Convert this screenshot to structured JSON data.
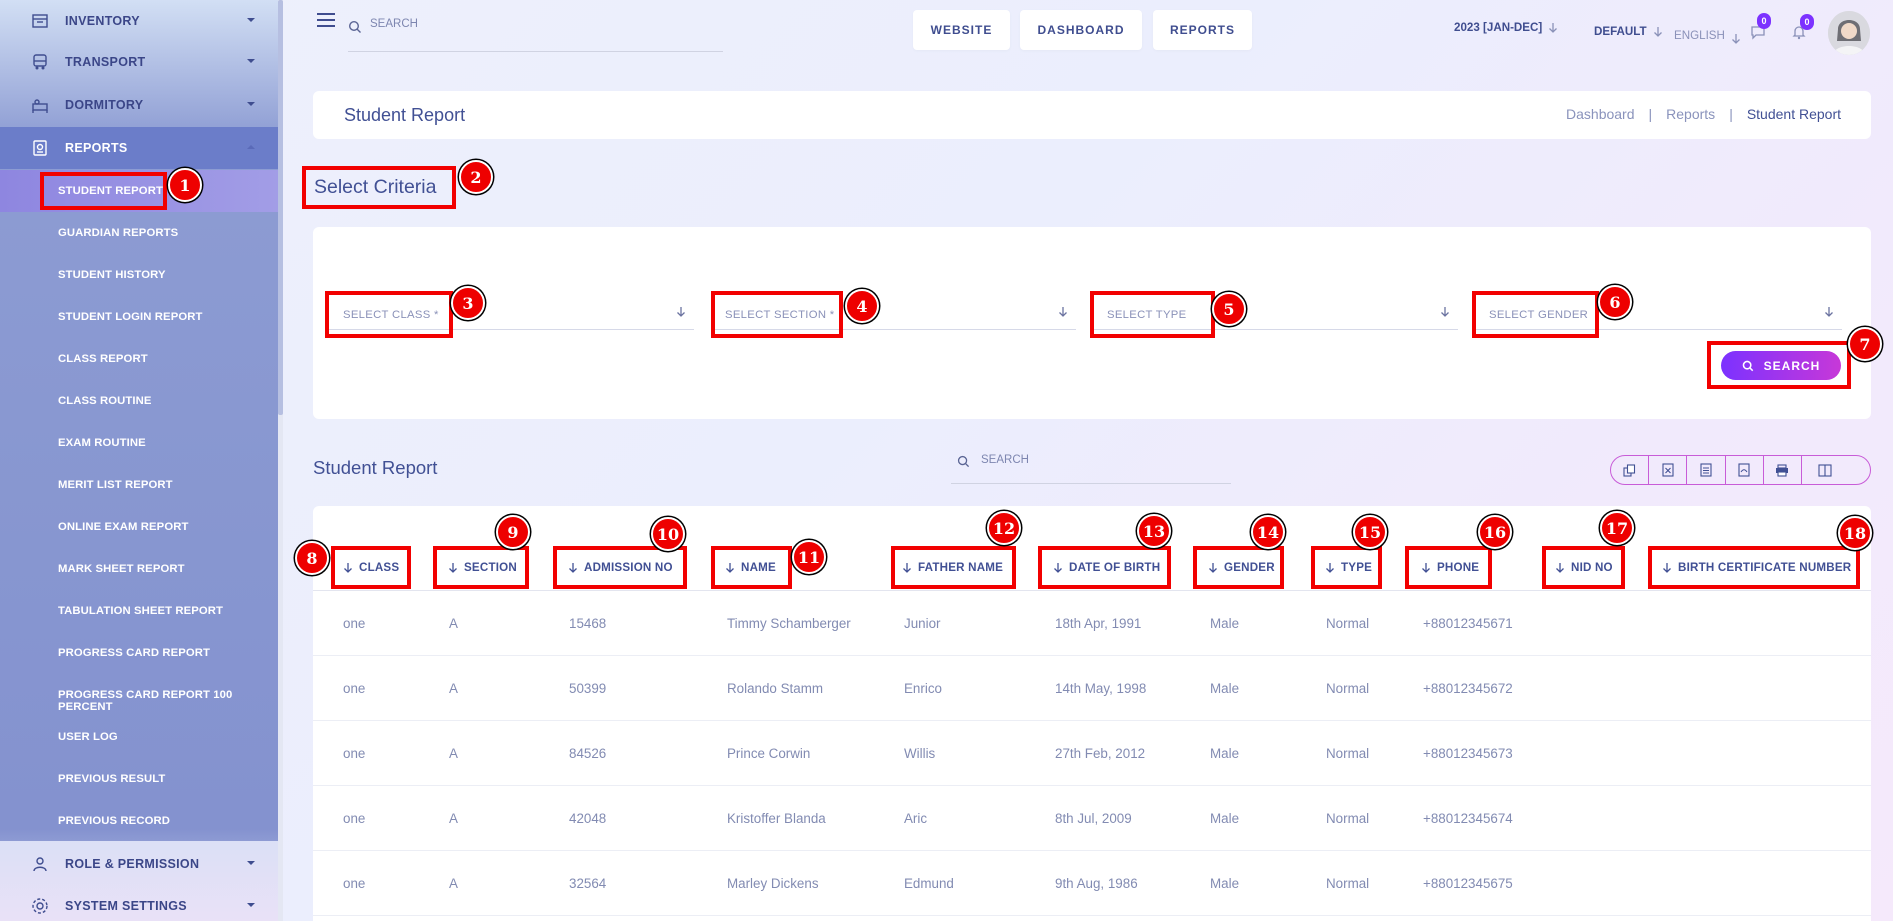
{
  "sidebar": {
    "menus": [
      {
        "key": "inventory",
        "label": "INVENTORY",
        "icon": "inventory-icon"
      },
      {
        "key": "transport",
        "label": "TRANSPORT",
        "icon": "transport-icon"
      },
      {
        "key": "dormitory",
        "label": "DORMITORY",
        "icon": "dormitory-icon"
      },
      {
        "key": "reports",
        "label": "REPORTS",
        "icon": "reports-icon"
      }
    ],
    "report_items": [
      "STUDENT REPORT",
      "GUARDIAN REPORTS",
      "STUDENT HISTORY",
      "STUDENT LOGIN REPORT",
      "CLASS REPORT",
      "CLASS ROUTINE",
      "EXAM ROUTINE",
      "MERIT LIST REPORT",
      "ONLINE EXAM REPORT",
      "MARK SHEET REPORT",
      "TABULATION SHEET REPORT",
      "PROGRESS CARD REPORT",
      "PROGRESS CARD REPORT 100 PERCENT",
      "USER LOG",
      "PREVIOUS RESULT",
      "PREVIOUS RECORD"
    ],
    "bottom_menus": [
      {
        "label": "ROLE & PERMISSION",
        "icon": "role-permission-icon"
      },
      {
        "label": "SYSTEM SETTINGS",
        "icon": "system-settings-icon"
      }
    ]
  },
  "header": {
    "search_placeholder": "SEARCH",
    "buttons": [
      "WEBSITE",
      "DASHBOARD",
      "REPORTS"
    ],
    "session": "2023 [JAN-DEC]",
    "theme": "DEFAULT",
    "language": "ENGLISH",
    "messages_count": "0",
    "notifications_count": "0"
  },
  "page": {
    "title": "Student Report",
    "breadcrumb": [
      "Dashboard",
      "Reports",
      "Student Report"
    ],
    "breadcrumb_sep": "|"
  },
  "criteria": {
    "title": "Select Criteria",
    "selects": [
      "SELECT CLASS *",
      "SELECT SECTION *",
      "SELECT TYPE",
      "SELECT GENDER"
    ],
    "search_button": "SEARCH"
  },
  "report": {
    "title": "Student Report",
    "search_placeholder": "SEARCH",
    "export_buttons": [
      "copy-icon",
      "excel-icon",
      "csv-icon",
      "pdf-icon",
      "print-icon",
      "columns-icon"
    ],
    "columns": [
      "CLASS",
      "SECTION",
      "ADMISSION NO",
      "NAME",
      "FATHER NAME",
      "DATE OF BIRTH",
      "GENDER",
      "TYPE",
      "PHONE",
      "NID NO",
      "BIRTH CERTIFICATE NUMBER"
    ],
    "rows": [
      [
        "one",
        "A",
        "15468",
        "Timmy Schamberger",
        "Junior",
        "18th Apr, 1991",
        "Male",
        "Normal",
        "+88012345671",
        "",
        ""
      ],
      [
        "one",
        "A",
        "50399",
        "Rolando Stamm",
        "Enrico",
        "14th May, 1998",
        "Male",
        "Normal",
        "+88012345672",
        "",
        ""
      ],
      [
        "one",
        "A",
        "84526",
        "Prince Corwin",
        "Willis",
        "27th Feb, 2012",
        "Male",
        "Normal",
        "+88012345673",
        "",
        ""
      ],
      [
        "one",
        "A",
        "42048",
        "Kristoffer Blanda",
        "Aric",
        "8th Jul, 2009",
        "Male",
        "Normal",
        "+88012345674",
        "",
        ""
      ],
      [
        "one",
        "A",
        "32564",
        "Marley Dickens",
        "Edmund",
        "9th Aug, 1986",
        "Male",
        "Normal",
        "+88012345675",
        "",
        ""
      ]
    ]
  },
  "markers": [
    "1",
    "2",
    "3",
    "4",
    "5",
    "6",
    "7",
    "8",
    "9",
    "10",
    "11",
    "12",
    "13",
    "14",
    "15",
    "16",
    "17",
    "18"
  ],
  "colors": {
    "accent": "#7c32ff",
    "accent2": "#c738d8",
    "marker": "#ee0000",
    "text": "#415094"
  }
}
